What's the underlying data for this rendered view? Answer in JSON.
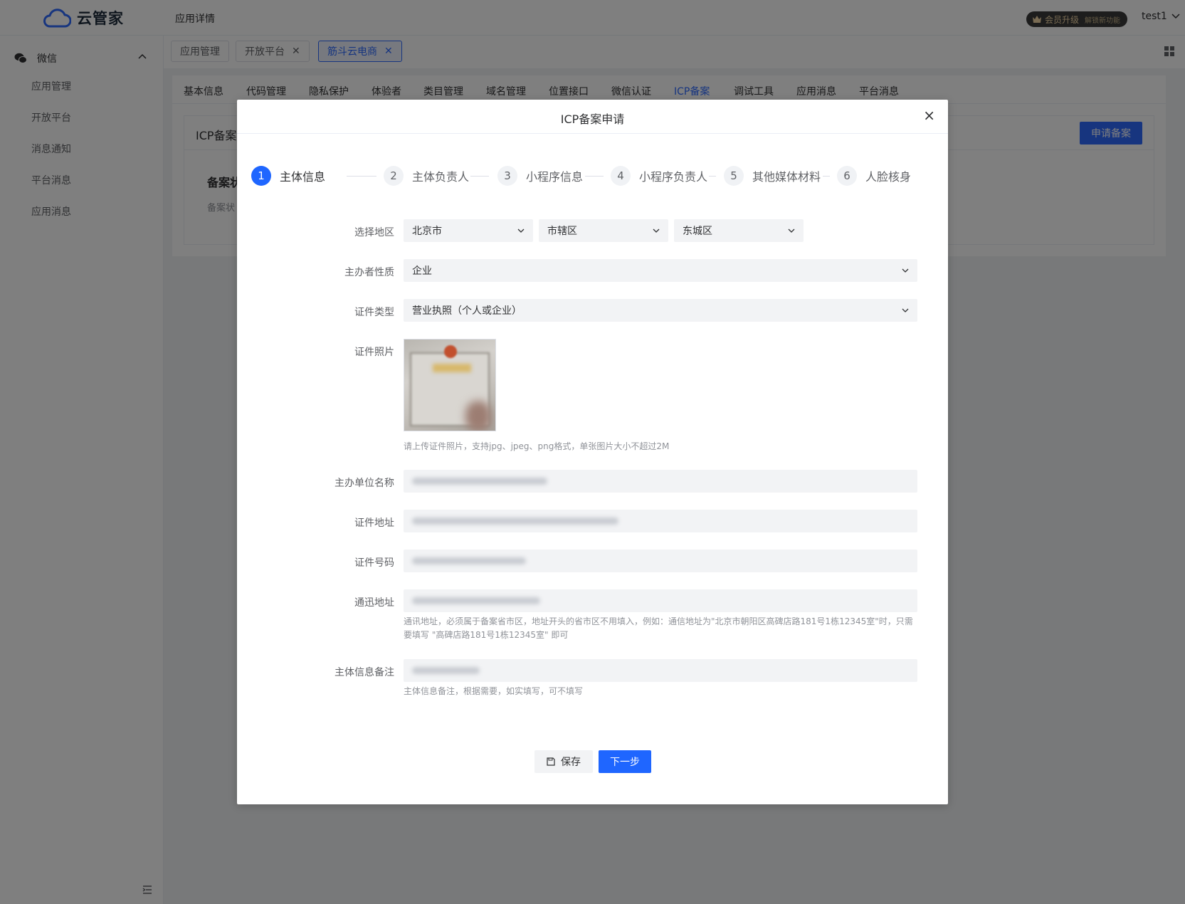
{
  "app": {
    "logo_text": "云管家",
    "page_title": "应用详情",
    "vip_label": "会员升级",
    "vip_sub": "解锁新功能",
    "username": "test1"
  },
  "sidebar": {
    "group_label": "微信",
    "items": [
      "应用管理",
      "开放平台",
      "消息通知",
      "平台消息",
      "应用消息"
    ]
  },
  "tags": [
    {
      "label": "应用管理",
      "closable": false,
      "active": false
    },
    {
      "label": "开放平台",
      "closable": true,
      "active": false
    },
    {
      "label": "筋斗云电商",
      "closable": true,
      "active": true
    }
  ],
  "content_tabs": {
    "items": [
      "基本信息",
      "代码管理",
      "隐私保护",
      "体验者",
      "类目管理",
      "域名管理",
      "位置接口",
      "微信认证",
      "ICP备案",
      "调试工具",
      "应用消息",
      "平台消息"
    ],
    "active_index": 8
  },
  "panel": {
    "title": "ICP备案",
    "apply_button": "申请备案",
    "status_label": "备案状",
    "status_sub": "备案状"
  },
  "modal": {
    "title": "ICP备案申请",
    "close_label": "×",
    "steps": [
      {
        "num": "1",
        "label": "主体信息"
      },
      {
        "num": "2",
        "label": "主体负责人"
      },
      {
        "num": "3",
        "label": "小程序信息"
      },
      {
        "num": "4",
        "label": "小程序负责人"
      },
      {
        "num": "5",
        "label": "其他媒体材料"
      },
      {
        "num": "6",
        "label": "人脸核身"
      }
    ],
    "active_step": 0,
    "form": {
      "region_label": "选择地区",
      "region_province": "北京市",
      "region_city": "市辖区",
      "region_district": "东城区",
      "sponsor_nature_label": "主办者性质",
      "sponsor_nature_value": "企业",
      "cert_type_label": "证件类型",
      "cert_type_value": "营业执照（个人或企业）",
      "cert_photo_label": "证件照片",
      "cert_photo_hint": "请上传证件照片，支持jpg、jpeg、png格式，单张图片大小不超过2M",
      "org_name_label": "主办单位名称",
      "cert_address_label": "证件地址",
      "cert_number_label": "证件号码",
      "mail_address_label": "通迅地址",
      "mail_address_hint": "通讯地址，必须属于备案省市区，地址开头的省市区不用填入，例如：通信地址为\"北京市朝阳区高碑店路181号1栋12345室\"时，只需要填写 \"高碑店路181号1栋12345室\" 即可",
      "remark_label": "主体信息备注",
      "remark_hint": "主体信息备注，根据需要，如实填写，可不填写"
    },
    "save_button": "保存",
    "next_button": "下一步"
  },
  "colors": {
    "primary": "#1f66ff",
    "overlay": "rgba(0,0,0,0.5)",
    "input_bg": "#f2f3f5"
  }
}
